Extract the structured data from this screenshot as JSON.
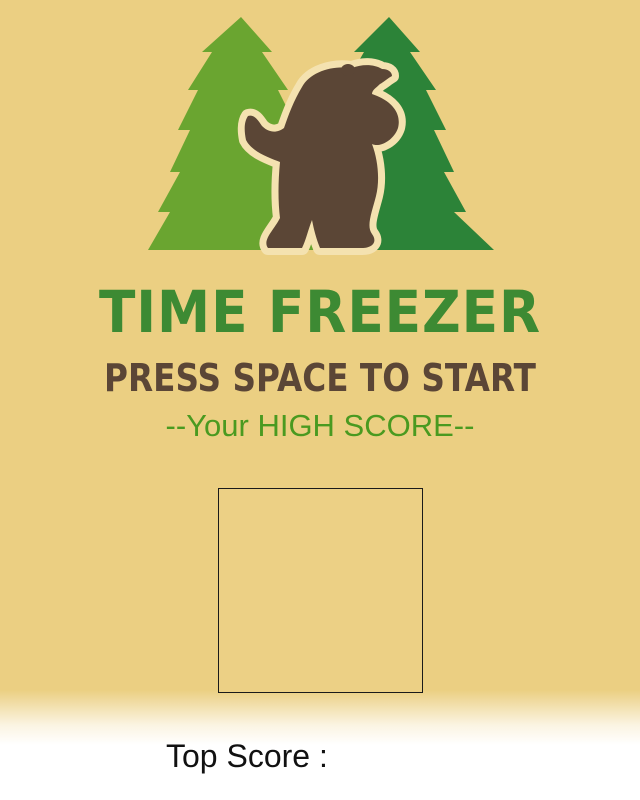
{
  "game": {
    "title": "TIME FREEZER",
    "start_prompt": "PRESS SPACE TO START",
    "high_score_heading": "--Your HIGH SCORE--",
    "high_score_value": "",
    "top_score_label": "Top Score :",
    "top_score_value": ""
  },
  "logo": {
    "icon": "bear-between-pine-trees-logo",
    "colors": {
      "left_tree": "#6aa530",
      "right_tree": "#2c8338",
      "bear": "#5b4636",
      "outline": "#f4e2b0"
    }
  },
  "colors": {
    "background": "#ebcf82",
    "title_green": "#3d8a33",
    "prompt_brown": "#5b4636",
    "subtitle_green": "#4a9a20",
    "footer": "#ffffff"
  }
}
